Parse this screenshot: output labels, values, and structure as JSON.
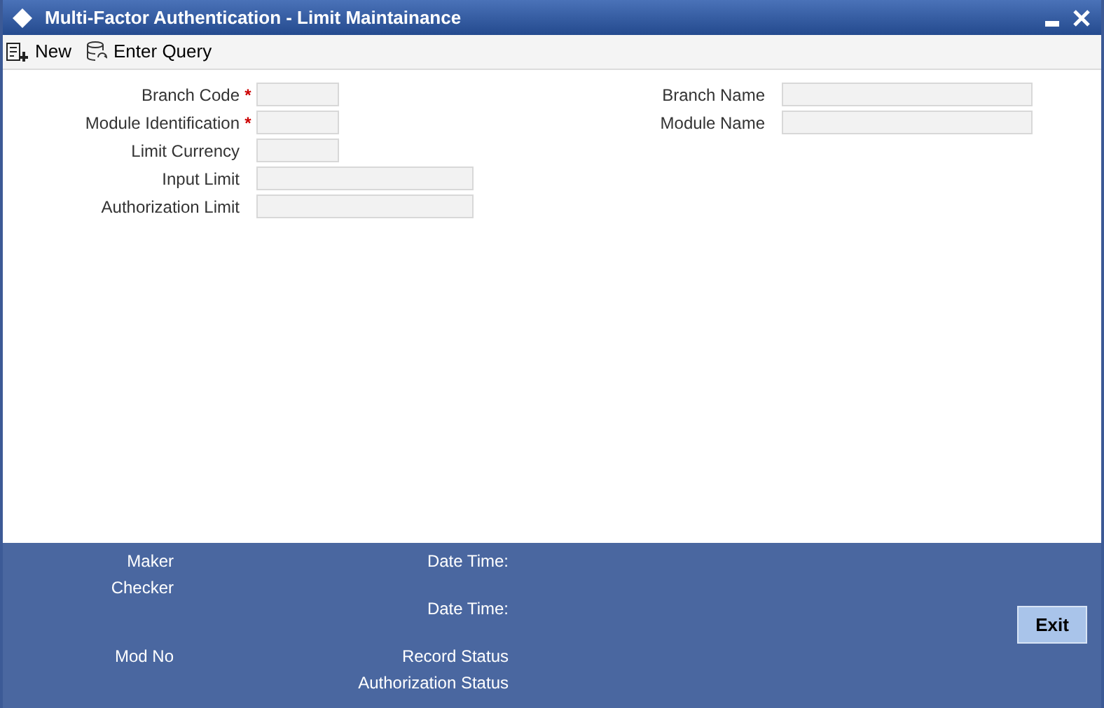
{
  "window": {
    "title": "Multi-Factor Authentication - Limit Maintainance"
  },
  "toolbar": [
    {
      "kind": "new",
      "label": "New"
    },
    {
      "kind": "query",
      "label": "Enter Query"
    }
  ],
  "form": {
    "left": [
      {
        "label": "Branch Code",
        "required_mark": "*"
      },
      {
        "label": "Module Identification",
        "required_mark": "*"
      },
      {
        "label": "Limit Currency"
      },
      {
        "label": "Input Limit"
      },
      {
        "label": "Authorization Limit"
      }
    ],
    "right": [
      {
        "label": "Branch Name"
      },
      {
        "label": "Module Name"
      }
    ]
  },
  "footer": {
    "column_1": [
      "Maker",
      "Checker",
      "Mod No"
    ],
    "column_2": [
      "Date Time:",
      "Date Time:",
      "Record Status",
      "Authorization Status"
    ],
    "button": "Exit"
  }
}
